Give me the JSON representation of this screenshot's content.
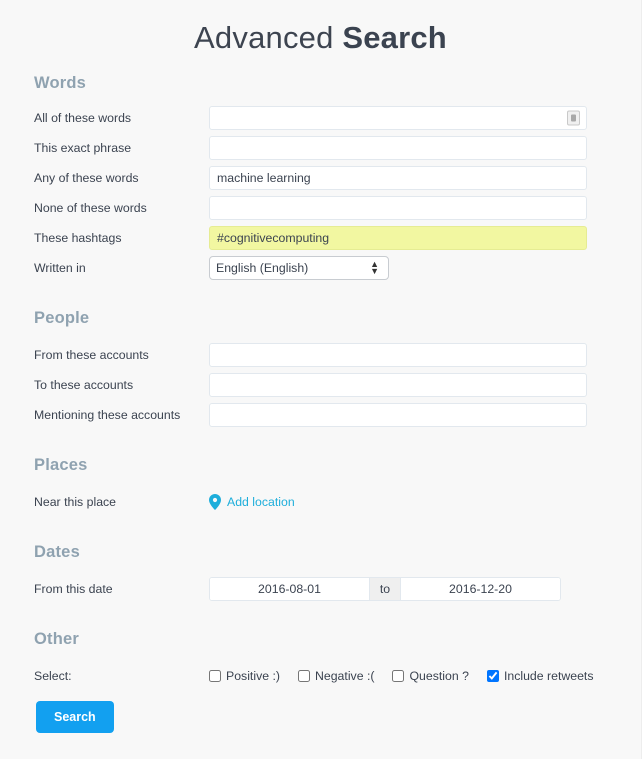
{
  "title": {
    "light": "Advanced ",
    "bold": "Search"
  },
  "sections": {
    "words": {
      "heading": "Words",
      "rows": [
        {
          "label": "All of these words",
          "value": "",
          "placeholder": ""
        },
        {
          "label": "This exact phrase",
          "value": "",
          "placeholder": ""
        },
        {
          "label": "Any of these words",
          "value": "machine learning",
          "placeholder": ""
        },
        {
          "label": "None of these words",
          "value": "",
          "placeholder": ""
        },
        {
          "label": "These hashtags",
          "value": "#cognitivecomputing",
          "placeholder": ""
        }
      ],
      "language": {
        "label": "Written in",
        "selected": "English (English)"
      }
    },
    "people": {
      "heading": "People",
      "rows": [
        {
          "label": "From these accounts",
          "value": "",
          "placeholder": ""
        },
        {
          "label": "To these accounts",
          "value": "",
          "placeholder": ""
        },
        {
          "label": "Mentioning these accounts",
          "value": "",
          "placeholder": ""
        }
      ]
    },
    "places": {
      "heading": "Places",
      "label": "Near this place",
      "add_location": "Add location",
      "pin_icon": "map-pin-icon"
    },
    "dates": {
      "heading": "Dates",
      "label": "From this date",
      "from": "2016-08-01",
      "separator": "to",
      "until": "2016-12-20"
    },
    "other": {
      "heading": "Other",
      "label": "Select:",
      "checkboxes": [
        {
          "label": "Positive :)",
          "checked": false
        },
        {
          "label": "Negative :(",
          "checked": false
        },
        {
          "label": "Question ?",
          "checked": false
        },
        {
          "label": "Include retweets",
          "checked": true
        }
      ]
    }
  },
  "submit": {
    "label": "Search"
  },
  "colors": {
    "page_bg": "#f8f8f8",
    "heading": "#8fa2b0",
    "text": "#3b4350",
    "accent": "#12a0f0",
    "link": "#1eaedb",
    "autofill": "#f2f7a1"
  }
}
